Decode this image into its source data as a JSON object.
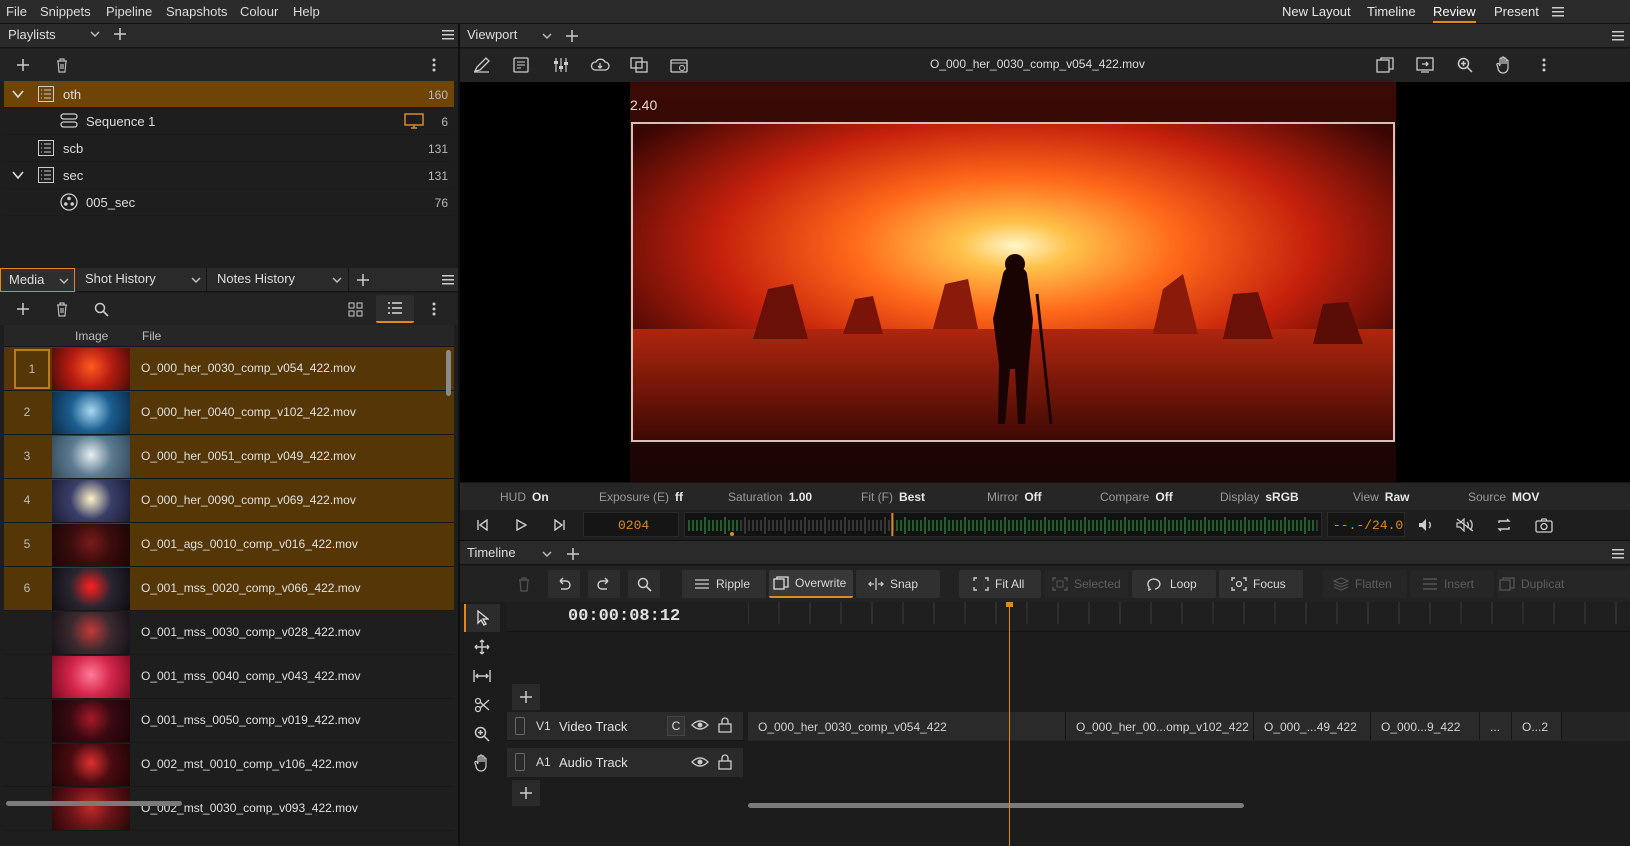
{
  "menubar": {
    "items": [
      "File",
      "Snippets",
      "Pipeline",
      "Snapshots",
      "Colour",
      "Help"
    ],
    "layouts": [
      "New Layout",
      "Timeline",
      "Review",
      "Present"
    ],
    "active_layout": "Review"
  },
  "playlists": {
    "title": "Playlists",
    "items": [
      {
        "label": "oth",
        "count": "160",
        "selected": true
      },
      {
        "label": "Sequence 1",
        "count": "6"
      },
      {
        "label": "scb",
        "count": "131"
      },
      {
        "label": "sec",
        "count": "131"
      },
      {
        "label": "005_sec",
        "count": "76"
      }
    ]
  },
  "media_tabs": [
    "Media",
    "Shot History",
    "Notes History"
  ],
  "media_table": {
    "columns": [
      "Image",
      "File"
    ],
    "rows": [
      {
        "num": "1",
        "file": "O_000_her_0030_comp_v054_422.mov",
        "selected": true,
        "thumb": [
          "#b81d12",
          "#ff5a20",
          "#4a0b06"
        ]
      },
      {
        "num": "2",
        "file": "O_000_her_0040_comp_v102_422.mov",
        "selected": true,
        "thumb": [
          "#1c5e90",
          "#a8d8f0",
          "#0b2a44"
        ]
      },
      {
        "num": "3",
        "file": "O_000_her_0051_comp_v049_422.mov",
        "selected": true,
        "thumb": [
          "#5d7b92",
          "#e8eef2",
          "#34495a"
        ]
      },
      {
        "num": "4",
        "file": "O_000_her_0090_comp_v069_422.mov",
        "selected": true,
        "thumb": [
          "#3a3f6a",
          "#fff3c8",
          "#1a1c33"
        ]
      },
      {
        "num": "5",
        "file": "O_001_ags_0010_comp_v016_422.mov",
        "selected": true,
        "thumb": [
          "#3a0d0d",
          "#7a1a1a",
          "#1a0505"
        ]
      },
      {
        "num": "6",
        "file": "O_001_mss_0020_comp_v066_422.mov",
        "selected": true,
        "thumb": [
          "#2a2630",
          "#ff2020",
          "#0e0c12"
        ]
      },
      {
        "num": "",
        "file": "O_001_mss_0030_comp_v028_422.mov",
        "selected": false,
        "thumb": [
          "#3a2a2e",
          "#c43a3a",
          "#15101a"
        ]
      },
      {
        "num": "",
        "file": "O_001_mss_0040_comp_v043_422.mov",
        "selected": false,
        "thumb": [
          "#d4264a",
          "#ff7a9a",
          "#7a0a22"
        ]
      },
      {
        "num": "",
        "file": "O_001_mss_0050_comp_v019_422.mov",
        "selected": false,
        "thumb": [
          "#3a0a12",
          "#a8182a",
          "#1a0408"
        ]
      },
      {
        "num": "",
        "file": "O_002_mst_0010_comp_v106_422.mov",
        "selected": false,
        "thumb": [
          "#4a0c10",
          "#e03030",
          "#200406"
        ]
      },
      {
        "num": "",
        "file": "O_002_mst_0030_comp_v093_422.mov",
        "selected": false,
        "thumb": [
          "#6a1418",
          "#c02a2a",
          "#2a0608"
        ]
      }
    ]
  },
  "viewport": {
    "tab": "Viewport",
    "filename": "O_000_her_0030_comp_v054_422.mov",
    "aspect_label": "2.40",
    "hud": [
      {
        "key": "HUD",
        "val": "On"
      },
      {
        "key": "Exposure (E)",
        "val": "ff"
      },
      {
        "key": "Saturation",
        "val": "1.00"
      },
      {
        "key": "Fit (F)",
        "val": "Best"
      },
      {
        "key": "Mirror",
        "val": "Off"
      },
      {
        "key": "Compare",
        "val": "Off"
      },
      {
        "key": "Display",
        "val": "sRGB"
      },
      {
        "key": "View",
        "val": "Raw"
      },
      {
        "key": "Source",
        "val": "MOV"
      }
    ],
    "frame": "0204",
    "fps": "--.-/24.0",
    "playhead_fraction": 0.325
  },
  "timeline": {
    "tab": "Timeline",
    "timecode": "00:00:08:12",
    "buttons": [
      {
        "label": "Ripple",
        "icon": "ripple-icon"
      },
      {
        "label": "Overwrite",
        "icon": "overwrite-icon",
        "active": true
      },
      {
        "label": "Snap",
        "icon": "snap-icon"
      },
      {
        "label": "Fit All",
        "icon": "fit-all-icon"
      },
      {
        "label": "Selected",
        "icon": "selected-icon",
        "disabled": true
      },
      {
        "label": "Loop",
        "icon": "loop-icon"
      },
      {
        "label": "Focus",
        "icon": "focus-icon"
      },
      {
        "label": "Flatten",
        "icon": "flatten-icon",
        "disabled": true
      },
      {
        "label": "Insert",
        "icon": "insert-icon",
        "disabled": true
      },
      {
        "label": "Duplicat",
        "icon": "duplicate-icon",
        "disabled": true
      }
    ],
    "tracks": [
      {
        "id": "V1",
        "name": "Video Track",
        "flag": "C"
      },
      {
        "id": "A1",
        "name": "Audio Track",
        "flag": ""
      }
    ],
    "clips": [
      "O_000_her_0030_comp_v054_422",
      "O_000_her_00...omp_v102_422",
      "O_000_...49_422",
      "O_000...9_422",
      "...",
      "O...2"
    ]
  },
  "colors": {
    "accent": "#e08a1e",
    "selection": "#5a3a08",
    "panel": "#1e1e1e"
  }
}
